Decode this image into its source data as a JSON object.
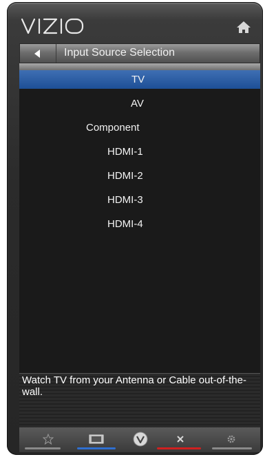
{
  "brand": {
    "logo_text": "VIZIO"
  },
  "header": {
    "title": "Input Source Selection"
  },
  "menu": {
    "items": [
      {
        "label": "TV",
        "selected": true
      },
      {
        "label": "AV",
        "selected": false
      },
      {
        "label": "Component",
        "selected": false
      },
      {
        "label": "HDMI-1",
        "selected": false
      },
      {
        "label": "HDMI-2",
        "selected": false
      },
      {
        "label": "HDMI-3",
        "selected": false
      },
      {
        "label": "HDMI-4",
        "selected": false
      }
    ]
  },
  "description": {
    "text": "Watch TV from your Antenna or Cable out-of-the-wall."
  },
  "toolbar": {
    "buttons": [
      {
        "icon": "star-icon",
        "accent": "#9a9a9a"
      },
      {
        "icon": "aspect-ratio-icon",
        "accent": "#2f6fd0"
      },
      {
        "icon": "vizio-v-icon",
        "accent": ""
      },
      {
        "icon": "close-x-icon",
        "accent": "#d02020"
      },
      {
        "icon": "gear-icon",
        "accent": "#9a9a9a"
      }
    ]
  },
  "colors": {
    "selected_highlight": "#2a5aa0",
    "frame": "#2b2b2b",
    "text": "#f2f2f2"
  }
}
